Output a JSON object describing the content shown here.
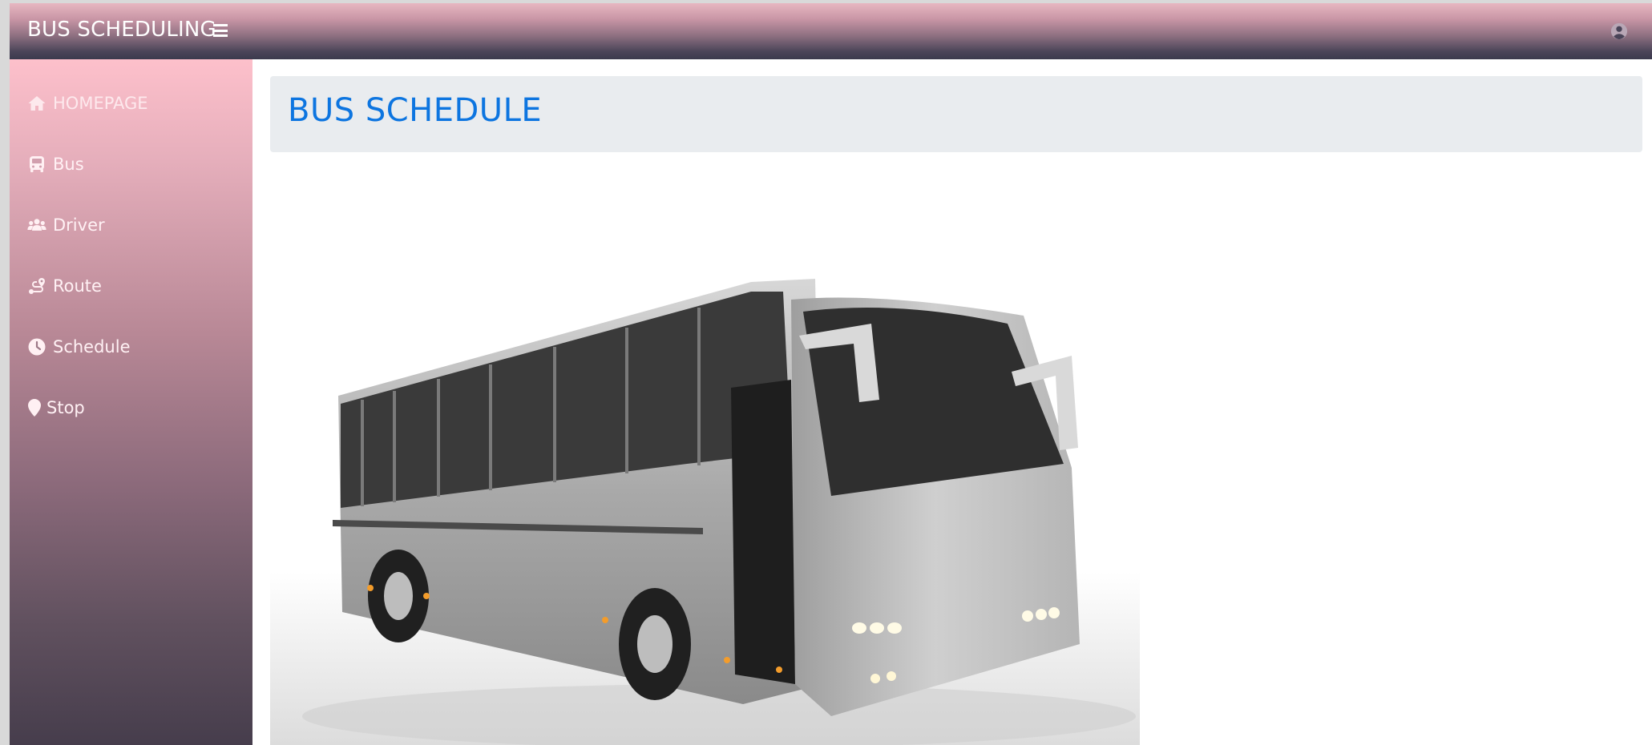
{
  "topbar": {
    "brand": "BUS SCHEDULING",
    "menu_icon": "hamburger-icon",
    "user_icon": "user-circle-icon"
  },
  "sidebar": {
    "items": [
      {
        "label": "HOMEPAGE",
        "icon": "home-icon",
        "active": true
      },
      {
        "label": "Bus",
        "icon": "bus-icon"
      },
      {
        "label": "Driver",
        "icon": "users-icon"
      },
      {
        "label": "Route",
        "icon": "route-icon"
      },
      {
        "label": "Schedule",
        "icon": "clock-icon"
      },
      {
        "label": "Stop",
        "icon": "map-pin-icon"
      }
    ]
  },
  "main": {
    "title": "BUS SCHEDULE",
    "image": "coach-bus-photo"
  },
  "colors": {
    "title": "#0d75e0",
    "header_bg": "#e9ecef",
    "sidebar_top": "#fdc0cb",
    "sidebar_bottom": "#463d4c"
  }
}
